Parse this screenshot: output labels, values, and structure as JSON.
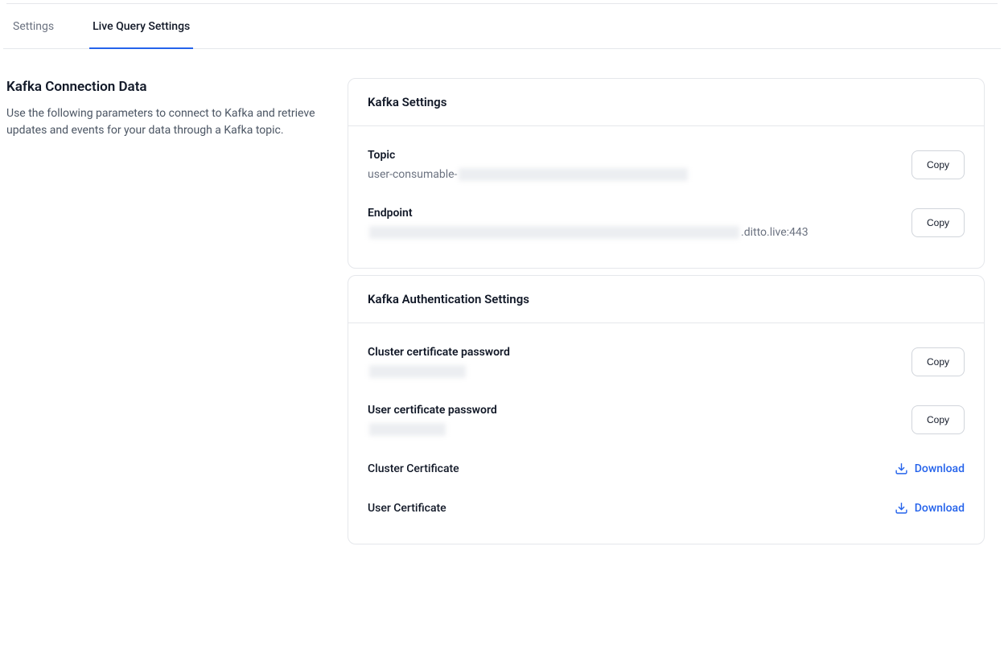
{
  "tabs": {
    "settings": "Settings",
    "liveQuery": "Live Query Settings"
  },
  "sidebar": {
    "title": "Kafka Connection Data",
    "description": "Use the following parameters to connect to Kafka and retrieve updates and events for your data through a Kafka topic."
  },
  "kafkaSettings": {
    "header": "Kafka Settings",
    "topic": {
      "label": "Topic",
      "valuePrefix": "user-consumable-",
      "copyLabel": "Copy"
    },
    "endpoint": {
      "label": "Endpoint",
      "valueSuffix": ".ditto.live:443",
      "copyLabel": "Copy"
    }
  },
  "kafkaAuth": {
    "header": "Kafka Authentication Settings",
    "clusterPassword": {
      "label": "Cluster certificate password",
      "copyLabel": "Copy"
    },
    "userPassword": {
      "label": "User certificate password",
      "copyLabel": "Copy"
    },
    "clusterCert": {
      "label": "Cluster Certificate",
      "downloadLabel": "Download"
    },
    "userCert": {
      "label": "User Certificate",
      "downloadLabel": "Download"
    }
  }
}
